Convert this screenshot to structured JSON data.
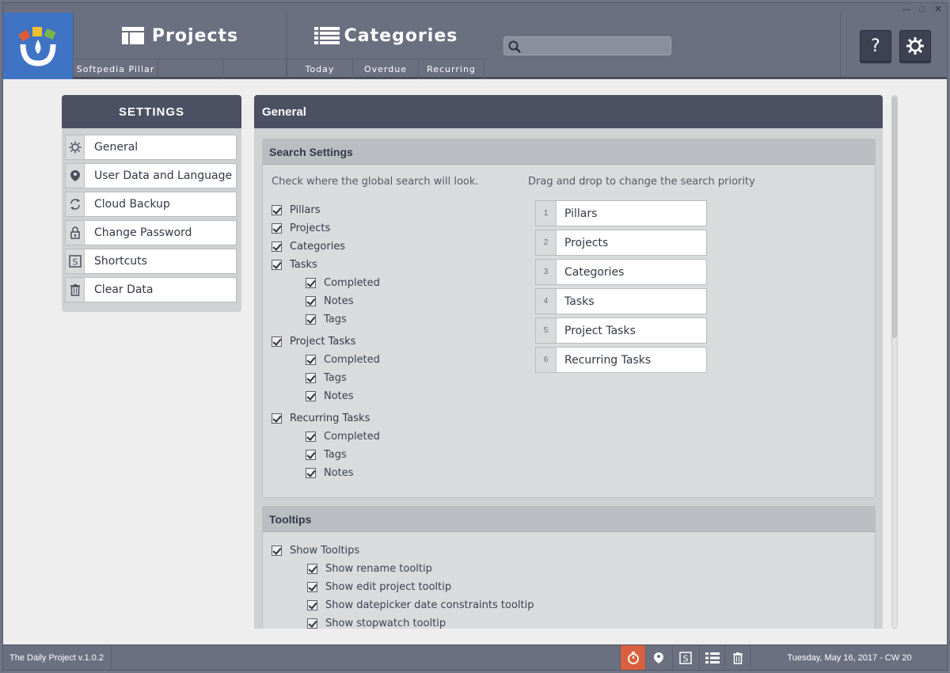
{
  "header": {
    "projects_label": "Projects",
    "categories_label": "Categories",
    "projects_subtabs": [
      "Softpedia Pillar",
      "",
      ""
    ],
    "categories_subtabs": [
      "Today",
      "Overdue",
      "Recurring"
    ],
    "search_placeholder": "",
    "help_label": "?"
  },
  "sidebar": {
    "title": "SETTINGS",
    "items": [
      {
        "label": "General",
        "icon": "gear-icon"
      },
      {
        "label": "User Data and Language",
        "icon": "user-pin-icon"
      },
      {
        "label": "Cloud Backup",
        "icon": "sync-icon"
      },
      {
        "label": "Change Password",
        "icon": "lock-icon"
      },
      {
        "label": "Shortcuts",
        "icon": "shortcut-s-icon"
      },
      {
        "label": "Clear Data",
        "icon": "trash-icon"
      }
    ]
  },
  "main": {
    "title": "General",
    "search_settings": {
      "title": "Search Settings",
      "check_desc": "Check where the global search will look.",
      "drag_desc": "Drag and drop to change the search priority",
      "checks": [
        {
          "label": "Pillars",
          "level": 0
        },
        {
          "label": "Projects",
          "level": 0
        },
        {
          "label": "Categories",
          "level": 0
        },
        {
          "label": "Tasks",
          "level": 0
        },
        {
          "label": "Completed",
          "level": 1
        },
        {
          "label": "Notes",
          "level": 1
        },
        {
          "label": "Tags",
          "level": 1
        },
        {
          "label": "Project Tasks",
          "level": 0
        },
        {
          "label": "Completed",
          "level": 1
        },
        {
          "label": "Tags",
          "level": 1
        },
        {
          "label": "Notes",
          "level": 1
        },
        {
          "label": "Recurring Tasks",
          "level": 0
        },
        {
          "label": "Completed",
          "level": 1
        },
        {
          "label": "Tags",
          "level": 1
        },
        {
          "label": "Notes",
          "level": 1
        }
      ],
      "priority": [
        {
          "num": "1",
          "label": "Pillars"
        },
        {
          "num": "2",
          "label": "Projects"
        },
        {
          "num": "3",
          "label": "Categories"
        },
        {
          "num": "4",
          "label": "Tasks"
        },
        {
          "num": "5",
          "label": "Project Tasks"
        },
        {
          "num": "6",
          "label": "Recurring Tasks"
        }
      ]
    },
    "tooltips": {
      "title": "Tooltips",
      "checks": [
        {
          "label": "Show Tooltips",
          "level": 0
        },
        {
          "label": "Show rename tooltip",
          "level": 1
        },
        {
          "label": "Show edit project tooltip",
          "level": 1
        },
        {
          "label": "Show datepicker date constraints tooltip",
          "level": 1
        },
        {
          "label": "Show stopwatch tooltip",
          "level": 1
        }
      ]
    }
  },
  "statusbar": {
    "version": "The Daily Project v.1.0.2",
    "date": "Tuesday, May 16, 2017 - CW 20",
    "icons": [
      "stopwatch-icon",
      "user-pin-icon",
      "shortcut-s-icon",
      "list-icon",
      "trash-icon"
    ]
  },
  "colors": {
    "accent": "#3f73c4",
    "header": "#6b7080",
    "dark_panel": "#4b5063",
    "active_status": "#d8603f"
  }
}
